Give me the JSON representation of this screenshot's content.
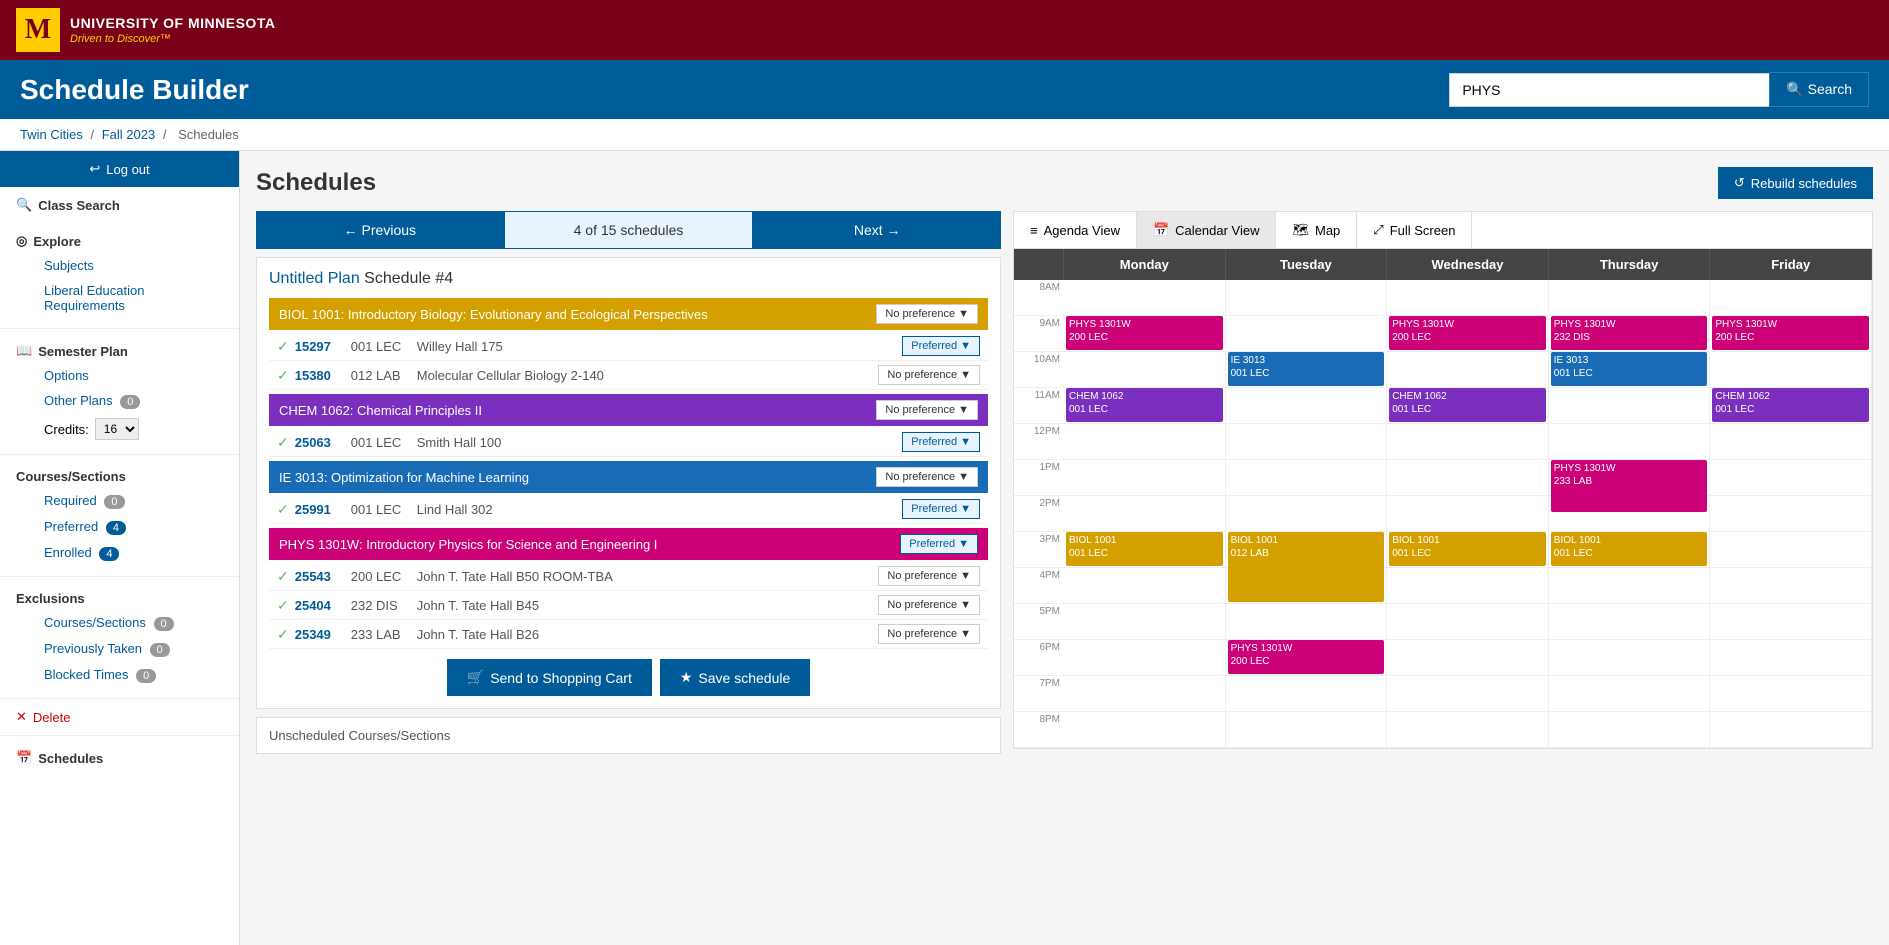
{
  "topbar": {
    "university": "UNIVERSITY OF MINNESOTA",
    "tagline": "Driven to Discover™",
    "logo_letter": "M"
  },
  "header": {
    "title": "Schedule Builder",
    "search_value": "PHYS",
    "search_placeholder": "Search",
    "search_btn": "Search"
  },
  "breadcrumb": {
    "items": [
      "Twin Cities",
      "Fall 2023",
      "Schedules"
    ]
  },
  "sidebar": {
    "logout_btn": "Log out",
    "class_search": "Class Search",
    "explore": "Explore",
    "subjects": "Subjects",
    "liberal_ed": "Liberal Education Requirements",
    "semester_plan": "Semester Plan",
    "options": "Options",
    "other_plans": "Other Plans",
    "other_plans_badge": "0",
    "credits_label": "Credits:",
    "credits_value": "16",
    "courses_sections": "Courses/Sections",
    "required": "Required",
    "required_badge": "0",
    "preferred": "Preferred",
    "preferred_badge": "4",
    "enrolled": "Enrolled",
    "enrolled_badge": "4",
    "exclusions": "Exclusions",
    "courses_excl": "Courses/Sections",
    "courses_excl_badge": "0",
    "prev_taken": "Previously Taken",
    "prev_taken_badge": "0",
    "blocked": "Blocked Times",
    "blocked_badge": "0",
    "delete": "Delete",
    "schedules": "Schedules"
  },
  "schedules_page": {
    "title": "Schedules",
    "rebuild_btn": "Rebuild schedules",
    "prev_btn": "Previous",
    "next_btn": "Next",
    "count_text": "4 of 15 schedules",
    "schedule_title_plan": "Untitled Plan",
    "schedule_title_num": "Schedule #4"
  },
  "courses": [
    {
      "id": "biol",
      "name": "BIOL 1001: Introductory Biology: Evolutionary and Ecological Perspectives",
      "color_class": "biol",
      "pref_label": "No preference",
      "sections": [
        {
          "num": "15297",
          "type": "001 LEC",
          "room": "Willey Hall",
          "room_num": "175",
          "pref": "Preferred",
          "is_preferred": true
        },
        {
          "num": "15380",
          "type": "012 LAB",
          "room": "Molecular Cellular Biology",
          "room_num": "2-140",
          "pref": "No preference",
          "is_preferred": false
        }
      ]
    },
    {
      "id": "chem",
      "name": "CHEM 1062: Chemical Principles II",
      "color_class": "chem",
      "pref_label": "No preference",
      "sections": [
        {
          "num": "25063",
          "type": "001 LEC",
          "room": "Smith Hall",
          "room_num": "100",
          "pref": "Preferred",
          "is_preferred": true
        }
      ]
    },
    {
      "id": "ie",
      "name": "IE 3013: Optimization for Machine Learning",
      "color_class": "ie",
      "pref_label": "No preference",
      "sections": [
        {
          "num": "25991",
          "type": "001 LEC",
          "room": "Lind Hall",
          "room_num": "302",
          "pref": "Preferred",
          "is_preferred": true
        }
      ]
    },
    {
      "id": "phys",
      "name": "PHYS 1301W: Introductory Physics for Science and Engineering I",
      "color_class": "phys",
      "pref_label": "Preferred",
      "sections": [
        {
          "num": "25543",
          "type": "200 LEC",
          "room": "John T. Tate Hall",
          "room_num": "B50\nROOM-TBA",
          "pref": "No preference",
          "is_preferred": false
        },
        {
          "num": "25404",
          "type": "232 DIS",
          "room": "John T. Tate Hall",
          "room_num": "B45",
          "pref": "No preference",
          "is_preferred": false
        },
        {
          "num": "25349",
          "type": "233 LAB",
          "room": "John T. Tate Hall",
          "room_num": "B26",
          "pref": "No preference",
          "is_preferred": false
        }
      ]
    }
  ],
  "action_btns": {
    "cart": "Send to Shopping Cart",
    "save": "Save schedule"
  },
  "calendar": {
    "tabs": [
      {
        "label": "Agenda View",
        "icon": "≡",
        "active": false
      },
      {
        "label": "Calendar View",
        "icon": "📅",
        "active": true
      },
      {
        "label": "Map",
        "icon": "🗺",
        "active": false
      },
      {
        "label": "Full Screen",
        "icon": "⤢",
        "active": false
      }
    ],
    "days": [
      "Monday",
      "Tuesday",
      "Wednesday",
      "Thursday",
      "Friday"
    ],
    "times": [
      "8AM",
      "9AM",
      "10AM",
      "11AM",
      "12PM",
      "1PM",
      "2PM",
      "3PM",
      "4PM",
      "5PM",
      "6PM",
      "7PM",
      "8PM"
    ],
    "events": {
      "monday": [
        {
          "label": "PHYS 1301W\n200 LEC",
          "color": "phys",
          "top_offset": 1,
          "duration": 1,
          "start_hour_idx": 1
        },
        {
          "label": "CHEM 1062\n001 LEC",
          "color": "chem",
          "start_hour_idx": 3,
          "duration": 1
        },
        {
          "label": "BIOL 1001\n001 LEC",
          "color": "biol",
          "start_hour_idx": 7,
          "duration": 1
        }
      ],
      "tuesday": [
        {
          "label": "IE 3013\n001 LEC",
          "color": "ie",
          "start_hour_idx": 2,
          "duration": 1
        },
        {
          "label": "BIOL 1001\n012 LAB",
          "color": "biol",
          "start_hour_idx": 7,
          "duration": 1
        },
        {
          "label": "PHYS 1301W\n200 LEC",
          "color": "phys",
          "start_hour_idx": 10,
          "duration": 1
        }
      ],
      "wednesday": [
        {
          "label": "PHYS 1301W\n200 LEC",
          "color": "phys",
          "start_hour_idx": 1,
          "duration": 1
        },
        {
          "label": "CHEM 1062\n001 LEC",
          "color": "chem",
          "start_hour_idx": 3,
          "duration": 1
        },
        {
          "label": "BIOL 1001\n001 LEC",
          "color": "biol",
          "start_hour_idx": 7,
          "duration": 1
        }
      ],
      "thursday": [
        {
          "label": "PHYS 1301W\n232 DIS",
          "color": "phys",
          "start_hour_idx": 1,
          "duration": 1
        },
        {
          "label": "IE 3013\n001 LEC",
          "color": "ie",
          "start_hour_idx": 2,
          "duration": 1
        },
        {
          "label": "PHYS 1301W\n233 LAB",
          "color": "phys",
          "start_hour_idx": 5,
          "duration": 1
        },
        {
          "label": "BIOL 1001\n001 LEC",
          "color": "biol",
          "start_hour_idx": 7,
          "duration": 1
        }
      ],
      "friday": [
        {
          "label": "PHYS 1301W\n200 LEC",
          "color": "phys",
          "start_hour_idx": 1,
          "duration": 1
        },
        {
          "label": "CHEM 1062\n001 LEC",
          "color": "chem",
          "start_hour_idx": 3,
          "duration": 1
        }
      ]
    }
  }
}
